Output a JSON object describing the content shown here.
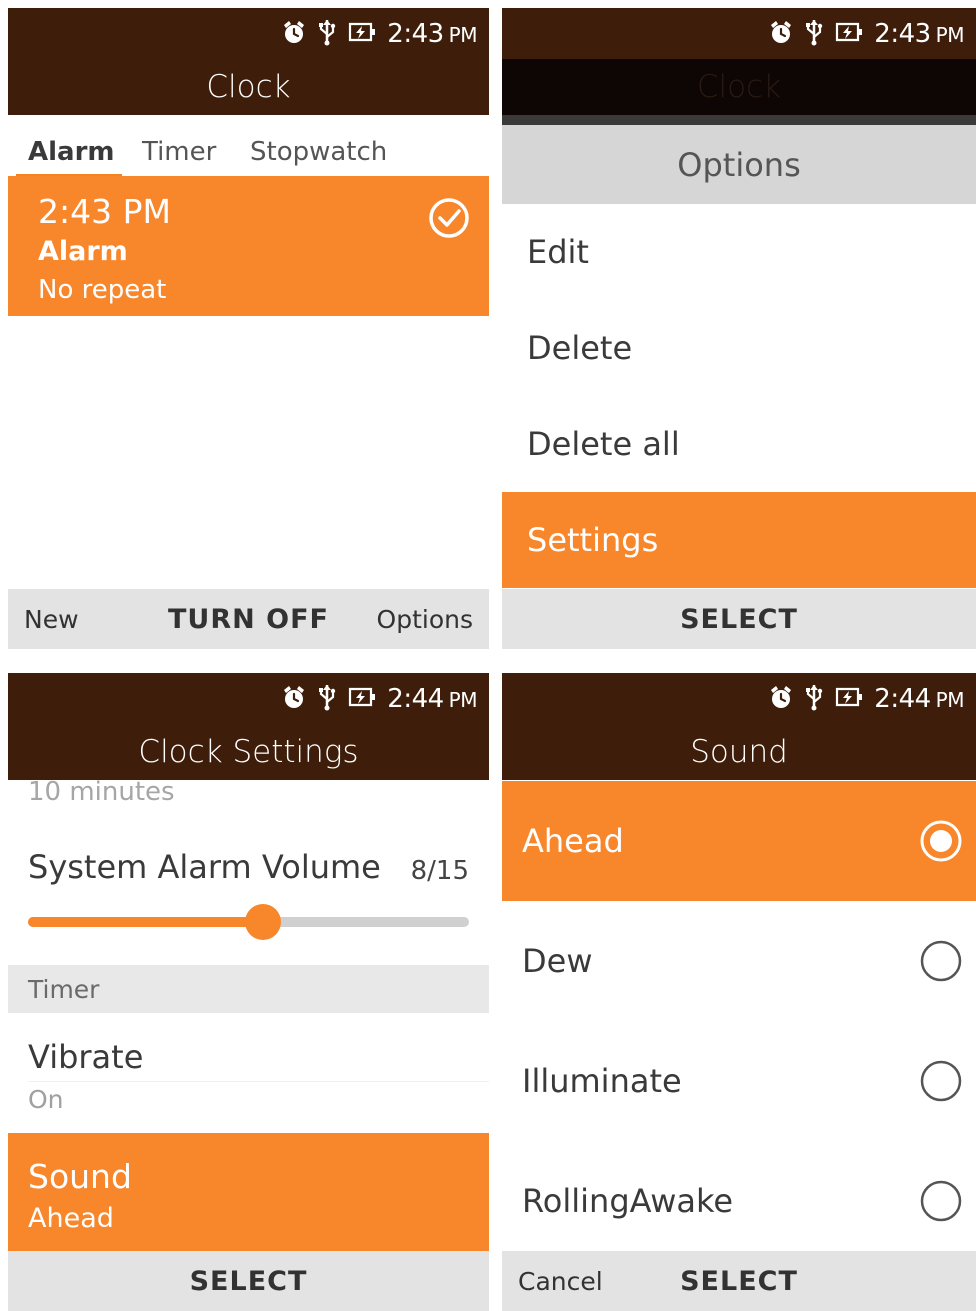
{
  "status": {
    "screen1_time": "2:43",
    "screen2_time": "2:43",
    "screen3_time": "2:44",
    "screen4_time": "2:44",
    "ampm": "PM",
    "icons": [
      "alarm-clock-icon",
      "usb-icon",
      "battery-charging-icon"
    ]
  },
  "screen1": {
    "title": "Clock",
    "tabs": [
      "Alarm",
      "Timer",
      "Stopwatch"
    ],
    "active_tab": "Alarm",
    "alarm": {
      "time": "2:43 PM",
      "label": "Alarm",
      "repeat": "No repeat",
      "enabled": true
    },
    "softkeys": {
      "left": "New",
      "center": "TURN OFF",
      "right": "Options"
    }
  },
  "screen2": {
    "title": "Clock",
    "options_header": "Options",
    "menu": [
      "Edit",
      "Delete",
      "Delete all",
      "Settings"
    ],
    "selected": "Settings",
    "softkeys": {
      "center": "SELECT"
    }
  },
  "screen3": {
    "title": "Clock Settings",
    "clipped_text": "10 minutes",
    "volume_label": "System Alarm Volume",
    "volume_value": "8/15",
    "volume_level": 8,
    "volume_max": 15,
    "section": "Timer",
    "vibrate_label": "Vibrate",
    "vibrate_value": "On",
    "sound_label": "Sound",
    "sound_value": "Ahead",
    "softkeys": {
      "center": "SELECT"
    }
  },
  "screen4": {
    "title": "Sound",
    "options": [
      "Ahead",
      "Dew",
      "Illuminate",
      "RollingAwake"
    ],
    "selected": "Ahead",
    "softkeys": {
      "left": "Cancel",
      "center": "SELECT"
    }
  },
  "colors": {
    "accent": "#f8862b",
    "header": "#3e1e0b",
    "softkey_bar": "#e3e3e3"
  }
}
